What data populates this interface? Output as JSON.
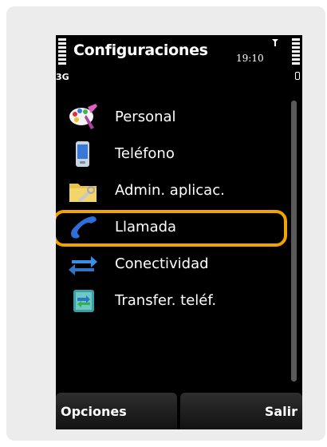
{
  "status_bar": {
    "title": "Configuraciones",
    "time": "19:10",
    "network": "3G"
  },
  "menu": {
    "items": [
      {
        "label": "Personal",
        "icon": "palette-icon"
      },
      {
        "label": "Teléfono",
        "icon": "phone-device-icon"
      },
      {
        "label": "Admin. aplicac.",
        "icon": "folder-tools-icon"
      },
      {
        "label": "Llamada",
        "icon": "handset-icon",
        "selected": true
      },
      {
        "label": "Conectividad",
        "icon": "arrows-exchange-icon"
      },
      {
        "label": "Transfer. teléf.",
        "icon": "phone-transfer-icon"
      }
    ]
  },
  "softkeys": {
    "left": "Opciones",
    "right": "Salir"
  },
  "colors": {
    "highlight": "#f0a400",
    "background": "#000000",
    "card": "#ececec"
  }
}
